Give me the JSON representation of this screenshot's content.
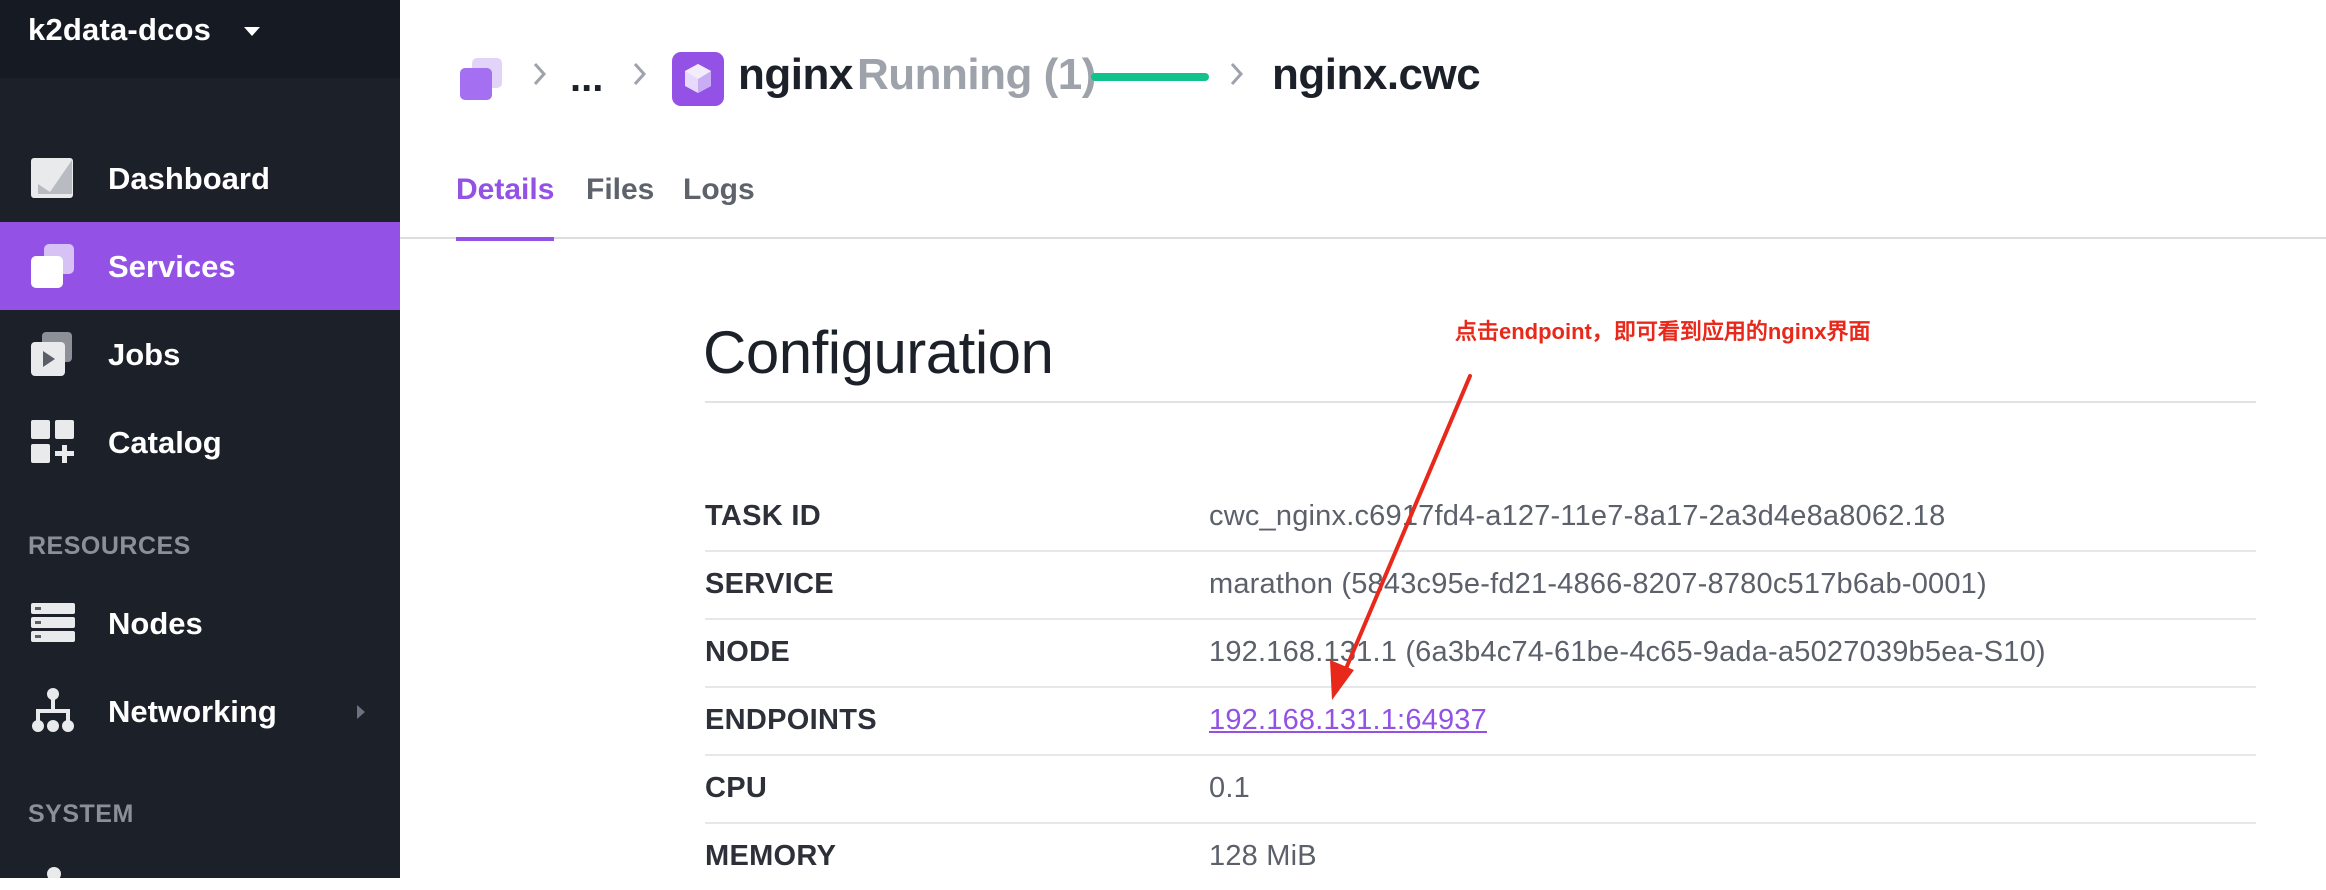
{
  "sidebar": {
    "cluster_name": "k2data-dcos",
    "items": [
      {
        "label": "Dashboard",
        "icon": "dashboard-icon"
      },
      {
        "label": "Services",
        "icon": "services-icon",
        "active": true
      },
      {
        "label": "Jobs",
        "icon": "jobs-icon"
      },
      {
        "label": "Catalog",
        "icon": "catalog-icon"
      },
      {
        "label": "Nodes",
        "icon": "nodes-icon"
      },
      {
        "label": "Networking",
        "icon": "networking-icon"
      }
    ],
    "sections": {
      "resources": "RESOURCES",
      "system": "SYSTEM"
    }
  },
  "breadcrumb": {
    "ellipsis": "...",
    "service": "nginx",
    "status": "Running (1)",
    "task": "nginx.cwc"
  },
  "tabs": [
    {
      "label": "Details",
      "active": true
    },
    {
      "label": "Files"
    },
    {
      "label": "Logs"
    }
  ],
  "config": {
    "title": "Configuration",
    "rows": [
      {
        "label": "TASK ID",
        "value": "cwc_nginx.c6917fd4-a127-11e7-8a17-2a3d4e8a8062.18"
      },
      {
        "label": "SERVICE",
        "value": "marathon (5843c95e-fd21-4866-8207-8780c517b6ab-0001)"
      },
      {
        "label": "NODE",
        "value": "192.168.131.1 (6a3b4c74-61be-4c65-9ada-a5027039b5ea-S10)"
      },
      {
        "label": "ENDPOINTS",
        "value": "192.168.131.1:64937"
      },
      {
        "label": "CPU",
        "value": "0.1"
      },
      {
        "label": "MEMORY",
        "value": "128 MiB"
      }
    ]
  },
  "annotation": "点击endpoint，即可看到应用的nginx界面",
  "colors": {
    "accent": "#9351e5",
    "sidebar_bg": "#1b2029",
    "status_running": "#12c28c",
    "annotation_red": "#e8281a"
  }
}
